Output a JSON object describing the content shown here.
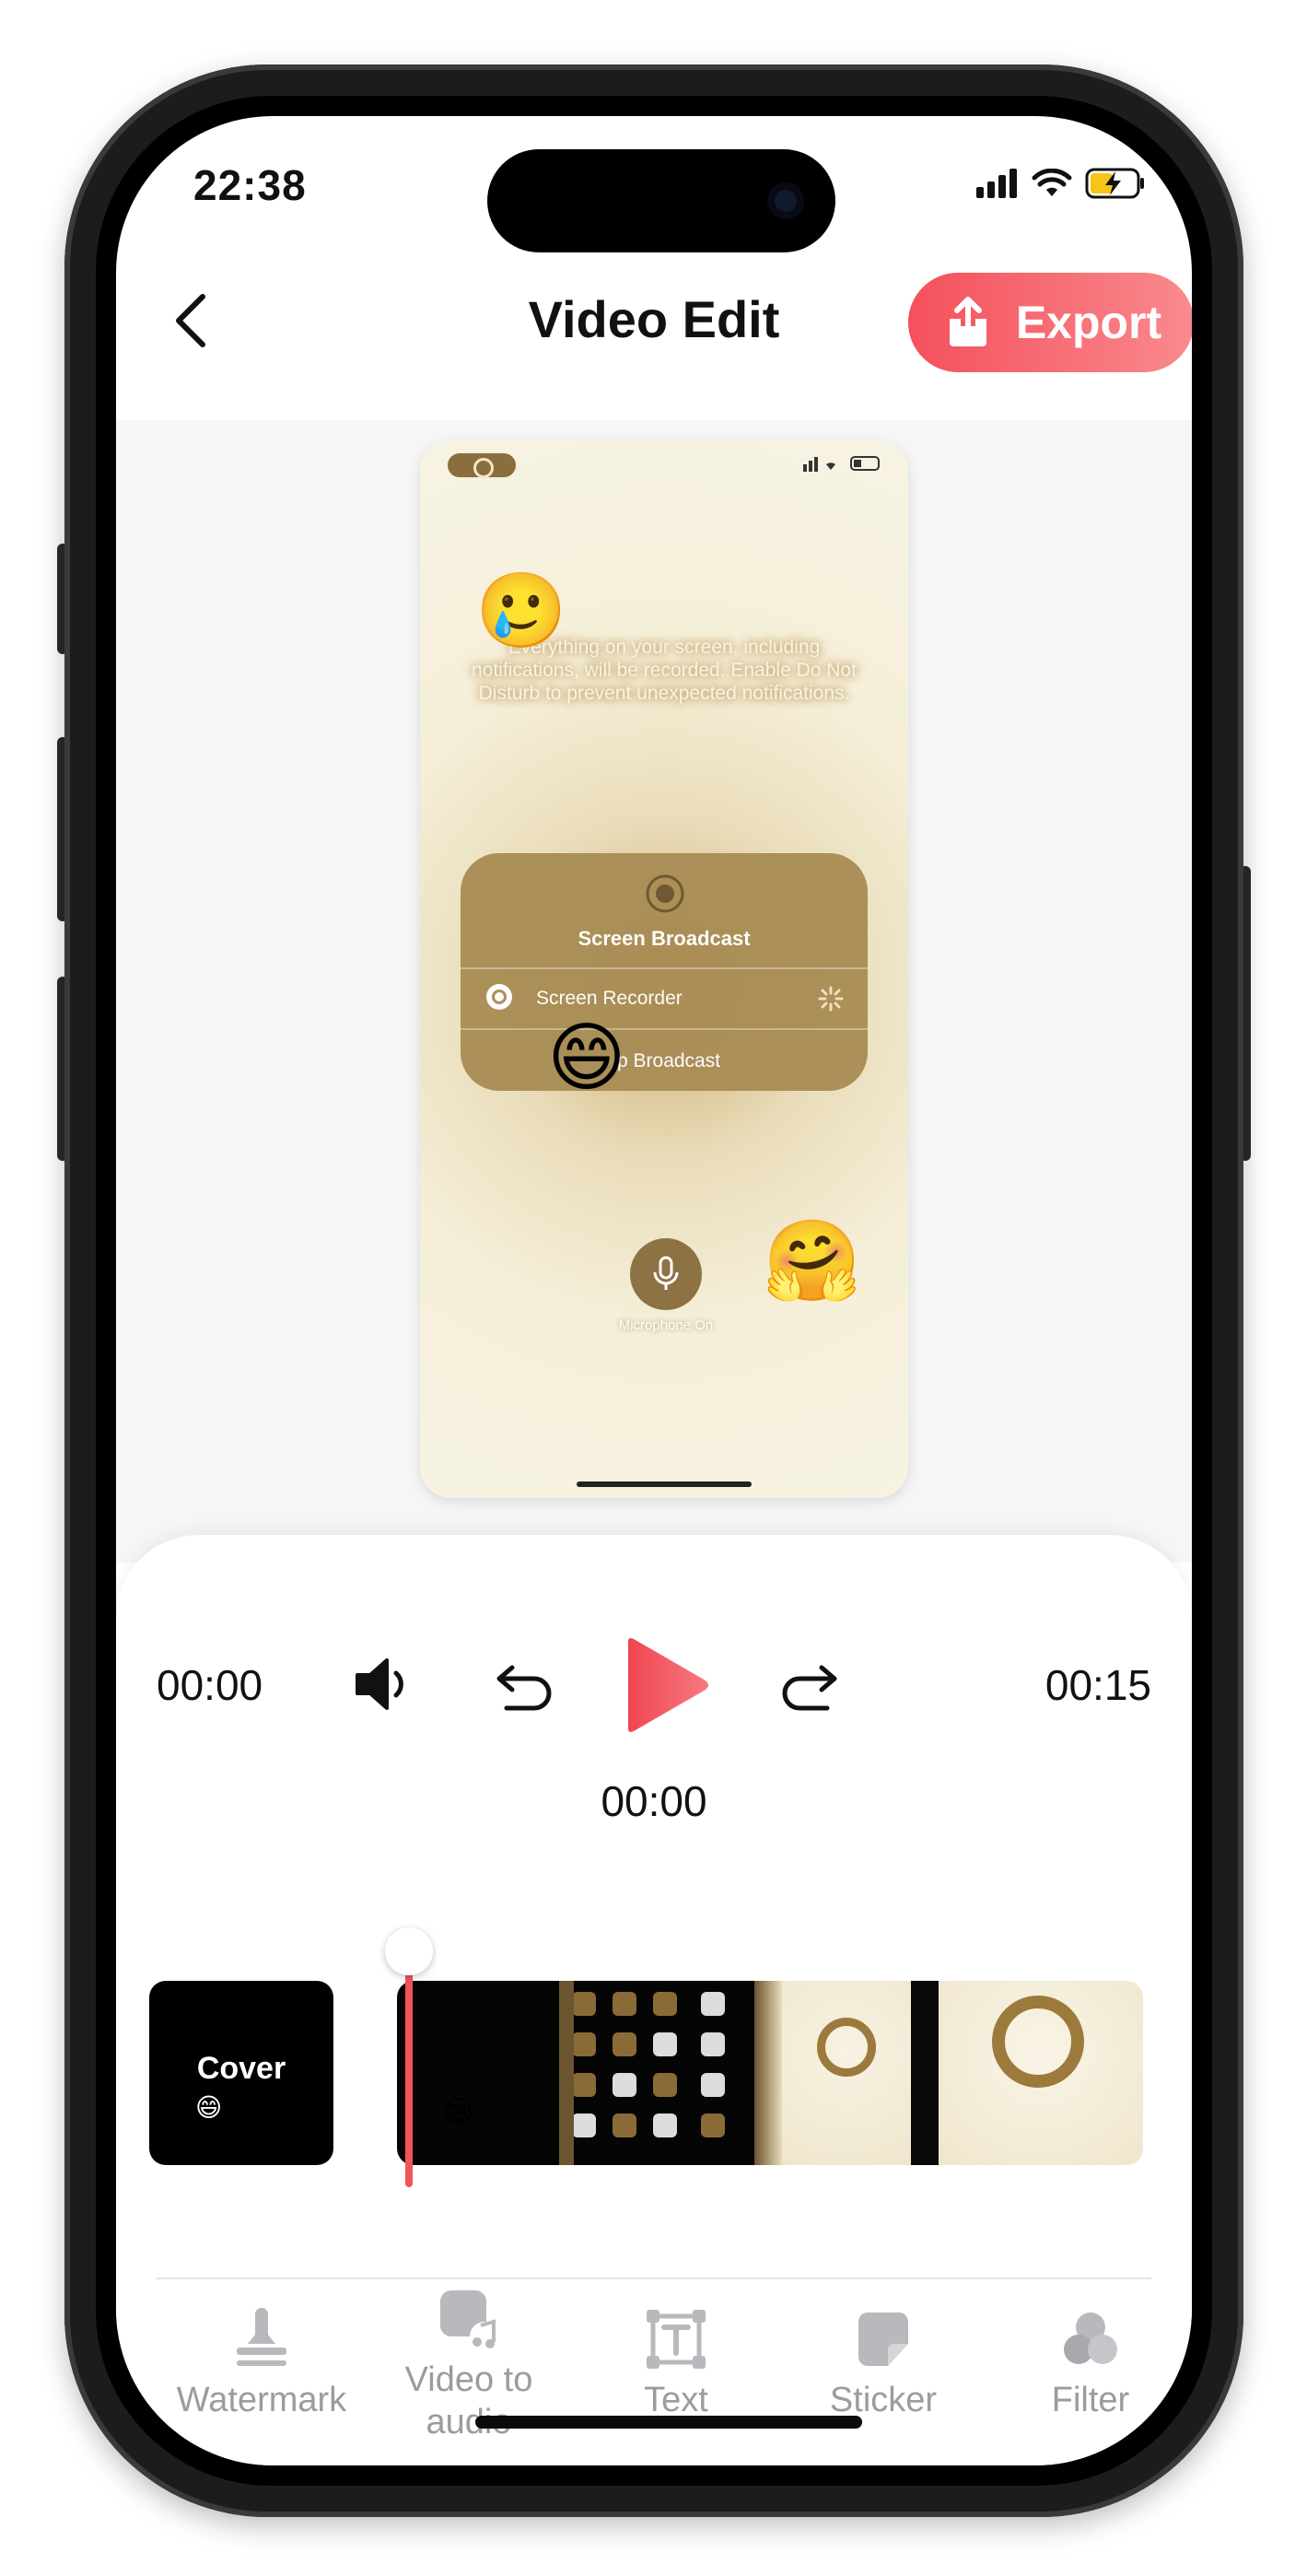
{
  "status_bar": {
    "time": "22:38"
  },
  "nav": {
    "title": "Video Edit",
    "export_label": "Export"
  },
  "preview": {
    "notice": "Everything on your screen, including notifications, will be recorded. Enable Do Not Disturb to prevent unexpected notifications.",
    "card_title": "Screen Broadcast",
    "card_row_recorder": "Screen Recorder",
    "card_row_broadcast": "p Broadcast",
    "mic_label": "Microphone On",
    "emoji_top": "🥲",
    "emoji_mid": "😄",
    "emoji_bottom": "🤗"
  },
  "player": {
    "current_time": "00:00",
    "total_time": "00:15",
    "scrub_time": "00:00"
  },
  "timeline": {
    "cover_label": "Cover",
    "cover_emoji": "😄",
    "clip_emoji": "😄"
  },
  "tools": [
    {
      "label": "Watermark",
      "icon": "stamp-icon"
    },
    {
      "label": "Video to audio",
      "icon": "video-to-audio-icon"
    },
    {
      "label": "Text",
      "icon": "text-frame-icon"
    },
    {
      "label": "Sticker",
      "icon": "sticker-icon"
    },
    {
      "label": "Filter",
      "icon": "filter-icon"
    }
  ],
  "colors": {
    "accent": "#f4505a",
    "tool_gray": "#9b9ba0"
  }
}
